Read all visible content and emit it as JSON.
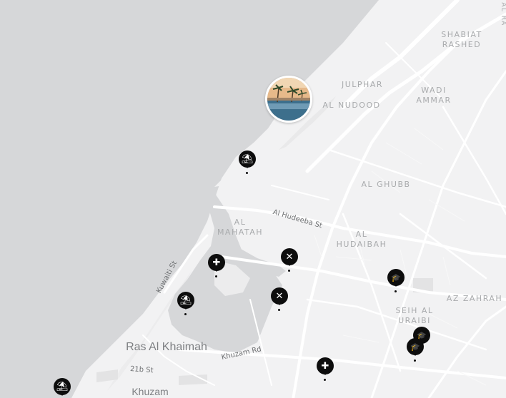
{
  "map": {
    "colors": {
      "sea": "#d6d7d9",
      "land": "#f2f2f3",
      "road": "#ffffff",
      "label": "#a9abad",
      "marker": "#0d0d0d"
    },
    "labels": {
      "shabiat_rashed": "SHABIAT\nRASHED",
      "julphar": "JULPHAR",
      "wadi_ammar": "WADI\nAMMAR",
      "al_nudood": "AL NUDOOD",
      "al_ghubb": "AL GHUBB",
      "al_mahatah": "AL\nMAHATAH",
      "al_hudaibah": "AL\nHUDAIBAH",
      "az_zahrah": "AZ ZAHRAH",
      "seih_al_uraibi": "SEIH AL\nURAIBI",
      "al_ra_partial": "AL RA",
      "city": "Ras Al Khaimah",
      "khuzam": "Khuzam"
    },
    "streets": {
      "al_hudeeba_st": "Al Hudeeba St",
      "kuwaiti_st": "Kuwaiti St",
      "khuzam_rd": "Khuzam Rd",
      "st_21b": "21b St"
    },
    "markers": [
      {
        "name": "beach-marker-1",
        "icon": "beach-umbrella-icon",
        "glyph": "⛱"
      },
      {
        "name": "beach-marker-2",
        "icon": "beach-umbrella-icon",
        "glyph": "⛱"
      },
      {
        "name": "beach-marker-3",
        "icon": "beach-umbrella-icon",
        "glyph": "⛱"
      },
      {
        "name": "hospital-marker-1",
        "icon": "medical-cross-icon",
        "glyph": "✚"
      },
      {
        "name": "hospital-marker-2",
        "icon": "medical-cross-icon",
        "glyph": "✚"
      },
      {
        "name": "restaurant-marker-1",
        "icon": "fork-knife-icon",
        "glyph": "✕"
      },
      {
        "name": "restaurant-marker-2",
        "icon": "fork-knife-icon",
        "glyph": "✕"
      },
      {
        "name": "school-marker-1",
        "icon": "graduation-cap-icon",
        "glyph": "🎓"
      },
      {
        "name": "school-marker-2",
        "icon": "graduation-cap-icon",
        "glyph": "🎓"
      },
      {
        "name": "school-marker-3",
        "icon": "graduation-cap-icon",
        "glyph": "🎓"
      }
    ],
    "photo_marker": {
      "icon": "photo-thumbnail-icon"
    }
  }
}
